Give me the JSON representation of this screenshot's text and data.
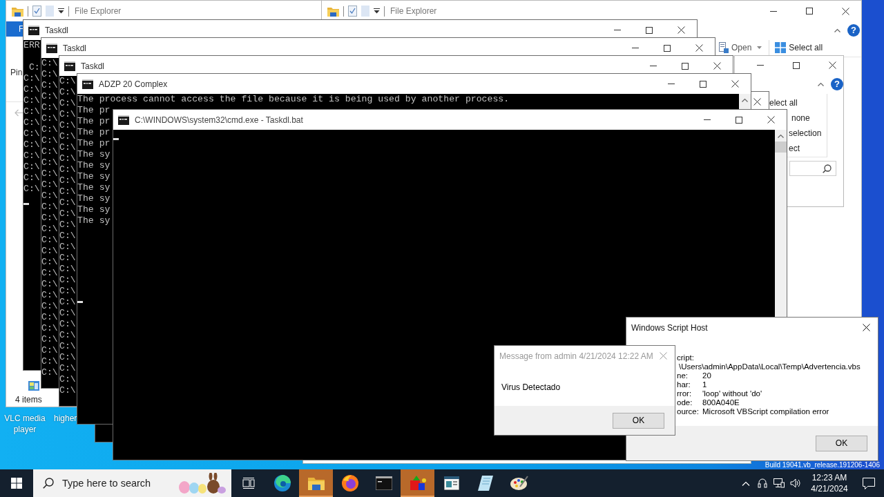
{
  "desktop": {
    "icons": [
      {
        "label": "VLC media player"
      },
      {
        "label": "higher"
      }
    ],
    "build_text": "Build 19041.vb_release.191206-1406"
  },
  "explorer_windows": [
    {
      "title": "File Explorer",
      "file_tab": "F",
      "ribbon_label": "Pin",
      "status": "4 items"
    },
    {
      "title": "File Explorer",
      "help": "?",
      "ribbon_items": [
        "Open",
        "Select all"
      ]
    },
    {
      "help": "?",
      "ribbon_items": [
        "elect all",
        "none",
        "selection",
        "ect"
      ]
    }
  ],
  "consoles": [
    {
      "title": "Taskdl",
      "lines": [
        "ERR",
        " C:",
        "C:\\",
        "C:\\",
        "C:\\",
        "C:\\",
        "C:\\",
        "C:\\",
        "C:\\",
        "C:\\",
        "C:\\",
        "C:\\",
        "C:\\"
      ],
      "cursor": true
    },
    {
      "title": "Taskdl",
      "lines": [
        "C:\\",
        "C:\\",
        "C:\\",
        "C:\\",
        "C:\\",
        "C:\\",
        "C:\\",
        "C:\\",
        "C:\\",
        "C:\\",
        "C:\\",
        "C:\\",
        "C:\\",
        "C:\\",
        "C:\\",
        "C:\\",
        "C:\\",
        "C:\\",
        "C:\\",
        "C:\\",
        "C:\\",
        "C:\\",
        "C:\\",
        "C:\\",
        "C:\\",
        "C:\\",
        "C:\\",
        "C:\\",
        "C:\\"
      ],
      "cursor": false
    },
    {
      "title": "Taskdl",
      "lines": [
        "C:\\",
        "C:\\",
        "C:\\",
        "C:\\",
        "C:\\",
        "C:\\",
        "C:\\",
        "C:\\",
        "C:\\",
        "C:\\",
        "C:\\",
        "C:\\",
        "C:\\",
        "C:\\",
        "C:\\",
        "C:\\",
        "C:\\",
        "C:\\",
        "C:\\",
        "C:\\",
        "C:\\",
        "C:\\",
        "C:\\",
        "C:\\",
        "C:\\",
        "C:\\",
        "C:\\",
        "C:\\",
        "C:\\"
      ],
      "cursor": false
    },
    {
      "title": "ADZP 20 Complex",
      "lines": [
        "The process cannot access the file because it is being used by another process.",
        "The pr",
        "The pr",
        "The pr",
        "The pr",
        "The sy",
        "The sy",
        "The sy",
        "The sy",
        "The sy",
        "The sy",
        "The sy"
      ],
      "cursor": true
    },
    {
      "cursor": false
    },
    {
      "title": "C:\\WINDOWS\\system32\\cmd.exe - Taskdl.bat",
      "cursor": true
    }
  ],
  "message_box": {
    "title": "Message from admin 4/21/2024 12:22 AM",
    "text": "Virus Detectado",
    "button": "OK"
  },
  "script_host": {
    "title": "Windows Script Host",
    "rows": [
      {
        "label": "cript:"
      },
      {
        "value": "\\Users\\admin\\AppData\\Local\\Temp\\Advertencia.vbs"
      },
      {
        "label": "ne:",
        "value": "20"
      },
      {
        "label": "har:",
        "value": "1"
      },
      {
        "label": "rror:",
        "value": "'loop' without 'do'"
      },
      {
        "label": "ode:",
        "value": "800A040E"
      },
      {
        "label": "ource:",
        "value": "Microsoft VBScript compilation error"
      }
    ],
    "button": "OK"
  },
  "taskbar": {
    "search_placeholder": "Type here to search",
    "apps": [
      {
        "flashing": false
      },
      {
        "flashing": false
      },
      {
        "flashing": true
      },
      {
        "flashing": false
      },
      {
        "flashing": false
      },
      {
        "flashing": true
      },
      {
        "flashing": false
      },
      {
        "flashing": false
      },
      {
        "flashing": false
      }
    ],
    "time": "12:23 AM",
    "date": "4/21/2024"
  }
}
